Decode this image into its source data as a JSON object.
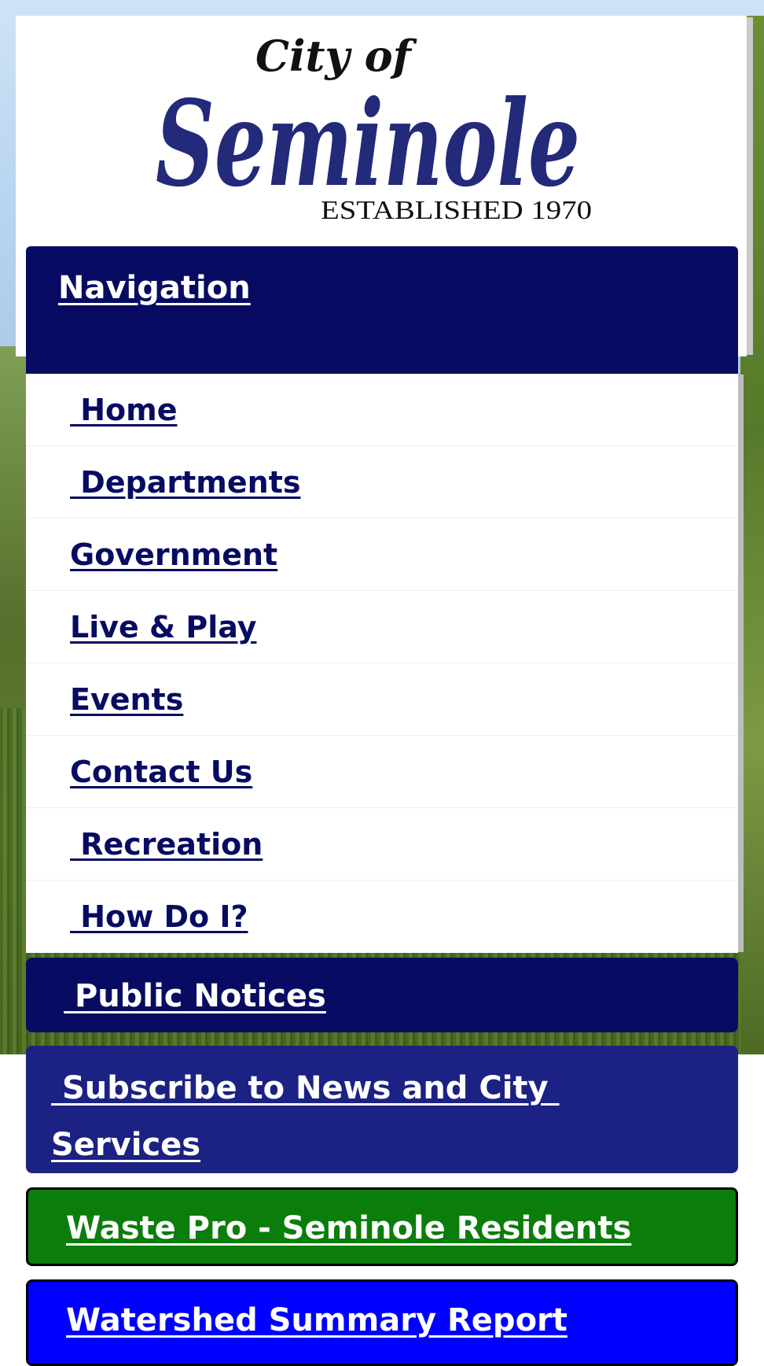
{
  "logo": {
    "top_text": "City of",
    "main_text": "Seminole",
    "established_text": "ESTABLISHED 1970",
    "brand_color": "#232a7a"
  },
  "nav": {
    "header_label": "Navigation",
    "items": [
      {
        "label": " Home"
      },
      {
        "label": " Departments"
      },
      {
        "label": "Government"
      },
      {
        "label": "Live & Play"
      },
      {
        "label": "Events"
      },
      {
        "label": "Contact Us"
      },
      {
        "label": " Recreation"
      },
      {
        "label": " How Do I?"
      }
    ]
  },
  "buttons": {
    "public_notices": " Public Notices",
    "subscribe": " Subscribe to News and City Services",
    "waste_pro": "Waste Pro - Seminole Residents",
    "watershed": "Watershed Summary Report"
  },
  "colors": {
    "nav_dark": "#070c62",
    "subscribe_blue": "#1c2283",
    "waste_green": "#0b7d0b",
    "watershed_blue": "#0000ff"
  }
}
